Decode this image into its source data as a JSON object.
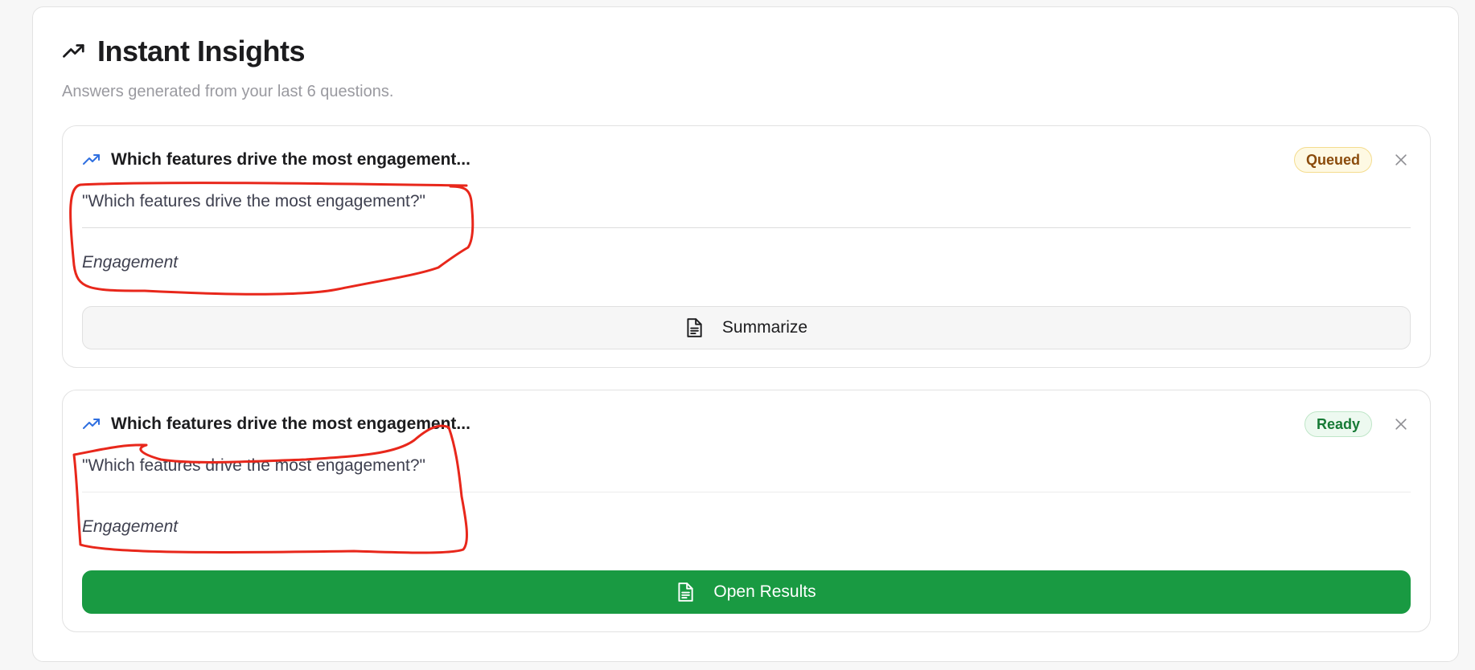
{
  "header": {
    "title": "Instant Insights",
    "subtitle": "Answers generated from your last 6 questions.",
    "icon": "trending-up-icon"
  },
  "cards": [
    {
      "title": "Which features drive the most engagement...",
      "status": "Queued",
      "question": "\"Which features drive the most engagement?\"",
      "category": "Engagement",
      "action_label": "Summarize",
      "action_icon": "document-icon"
    },
    {
      "title": "Which features drive the most engagement...",
      "status": "Ready",
      "question": "\"Which features drive the most engagement?\"",
      "category": "Engagement",
      "action_label": "Open Results",
      "action_icon": "document-icon"
    }
  ],
  "colors": {
    "accent_blue": "#2f6fe0",
    "success_green": "#199a42",
    "queued_text": "#8a4b0b",
    "queued_bg": "#fef9e3",
    "ready_text": "#177a36",
    "ready_bg": "#edf9f0",
    "annotation_red": "#e8271b"
  }
}
